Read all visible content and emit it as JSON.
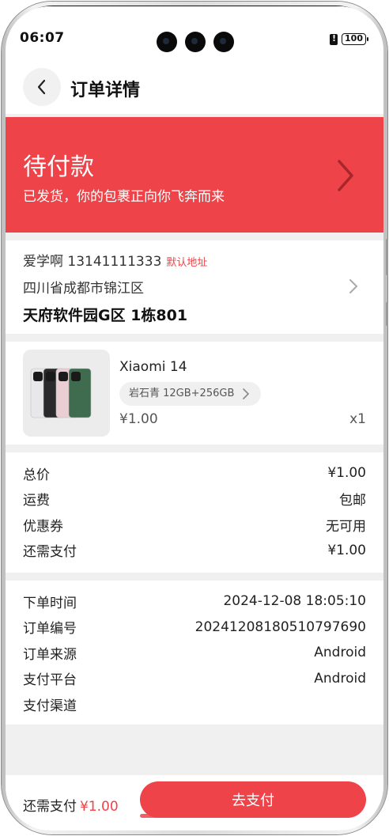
{
  "status_bar": {
    "time": "06:07",
    "battery": "100"
  },
  "header": {
    "title": "订单详情"
  },
  "order_status": {
    "title": "待付款",
    "subtitle": "已发货，你的包裹正向你飞奔而来"
  },
  "address": {
    "name_phone": "爱学啊 13141111333",
    "default_tag": "默认地址",
    "region": "四川省成都市锦江区",
    "detail": "天府软件园G区 1栋801"
  },
  "product": {
    "name": "Xiaomi 14",
    "spec": "岩石青 12GB+256GB",
    "price": "¥1.00",
    "quantity": "x1",
    "image_colors": [
      "#e8e8ea",
      "#2a2a2c",
      "#e9cfd3",
      "#3f6b4f"
    ]
  },
  "costs": [
    {
      "label": "总价",
      "value": "¥1.00"
    },
    {
      "label": "运费",
      "value": "包邮"
    },
    {
      "label": "优惠券",
      "value": "无可用"
    },
    {
      "label": "还需支付",
      "value": "¥1.00"
    }
  ],
  "order_info": [
    {
      "label": "下单时间",
      "value": "2024-12-08 18:05:10"
    },
    {
      "label": "订单编号",
      "value": "20241208180510797690"
    },
    {
      "label": "订单来源",
      "value": "Android"
    },
    {
      "label": "支付平台",
      "value": "Android"
    },
    {
      "label": "支付渠道",
      "value": ""
    }
  ],
  "bottom_bar": {
    "due_label": "还需支付",
    "due_amount": "¥1.00",
    "pay_button": "去支付"
  },
  "colors": {
    "accent": "#ee4348",
    "background": "#f0f0f0"
  },
  "icons": {
    "back": "chevron-left-icon",
    "forward": "chevron-right-icon"
  }
}
